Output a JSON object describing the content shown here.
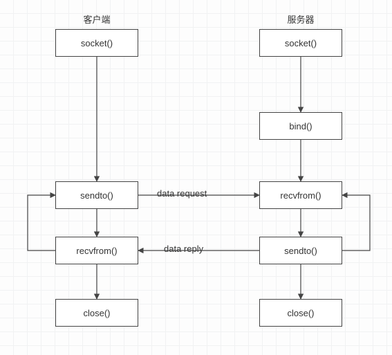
{
  "headers": {
    "client": "客户端",
    "server": "服务器"
  },
  "client": {
    "socket": "socket()",
    "sendto": "sendto()",
    "recvfrom": "recvfrom()",
    "close": "close()"
  },
  "server": {
    "socket": "socket()",
    "bind": "bind()",
    "recvfrom": "recvfrom()",
    "sendto": "sendto()",
    "close": "close()"
  },
  "edges": {
    "request": "data request",
    "reply": "data reply"
  }
}
